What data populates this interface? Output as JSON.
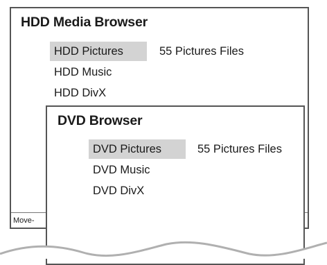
{
  "hdd_browser": {
    "title": "HDD Media Browser",
    "items": [
      {
        "label": "HDD Pictures",
        "selected": true
      },
      {
        "label": "HDD Music",
        "selected": false
      },
      {
        "label": "HDD DivX",
        "selected": false
      }
    ],
    "selected_info": "55 Pictures Files",
    "footer_text": "Move-"
  },
  "dvd_browser": {
    "title": "DVD Browser",
    "items": [
      {
        "label": "DVD Pictures",
        "selected": true
      },
      {
        "label": "DVD Music",
        "selected": false
      },
      {
        "label": "DVD DivX",
        "selected": false
      }
    ],
    "selected_info": "55 Pictures Files"
  },
  "colors": {
    "frame": "#555555",
    "selection": "#d3d3d3",
    "background": "#ffffff"
  }
}
